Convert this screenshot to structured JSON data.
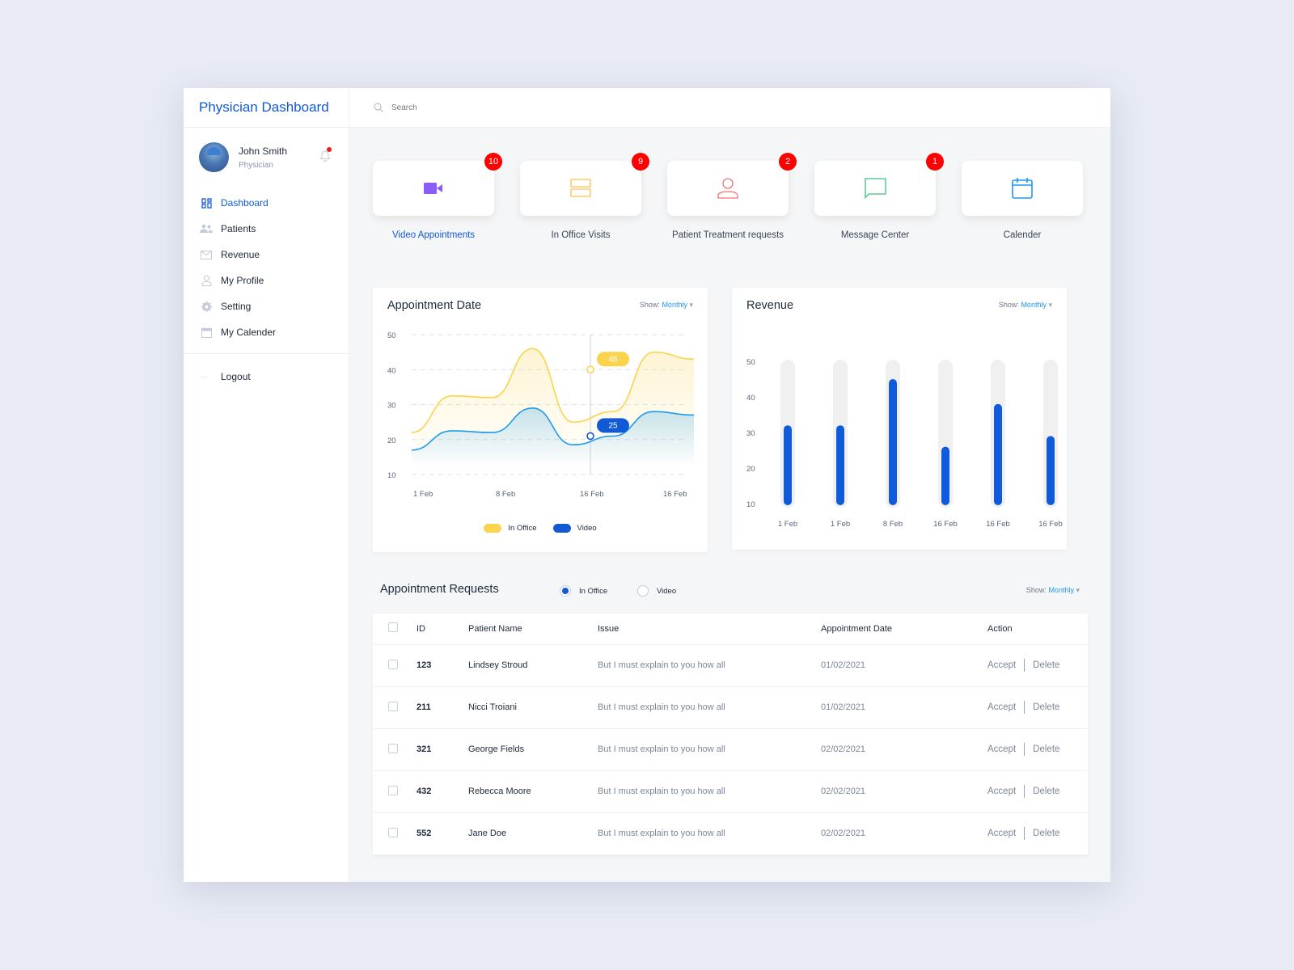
{
  "sidebar": {
    "brand": "Physician Dashboard",
    "user": {
      "name": "John Smith",
      "role": "Physician"
    },
    "nav": [
      {
        "label": "Dashboard",
        "icon": "grid-icon",
        "active": true
      },
      {
        "label": "Patients",
        "icon": "users-icon"
      },
      {
        "label": "Revenue",
        "icon": "mail-icon"
      },
      {
        "label": "My Profile",
        "icon": "user-icon"
      },
      {
        "label": "Setting",
        "icon": "gear-icon"
      },
      {
        "label": "My Calender",
        "icon": "calendar-icon"
      }
    ],
    "logout": "Logout"
  },
  "topbar": {
    "search_placeholder": "Search"
  },
  "tiles": [
    {
      "label": "Video Appointments",
      "badge": "10",
      "icon": "video-icon",
      "color": "#8b5cf6",
      "active": true
    },
    {
      "label": "In Office Visits",
      "badge": "9",
      "icon": "office-icon",
      "color": "#fbbf4a"
    },
    {
      "label": "Patient Treatment requests",
      "badge": "2",
      "icon": "patient-icon",
      "color": "#f87171"
    },
    {
      "label": "Message Center",
      "badge": "1",
      "icon": "message-icon",
      "color": "#34c77b"
    },
    {
      "label": "Calender",
      "badge": null,
      "icon": "calendar-icon",
      "color": "#2196f3"
    }
  ],
  "appointment_chart": {
    "title": "Appointment Date",
    "show_label": "Show:",
    "show_value": "Monthly",
    "legend": [
      "In Office",
      "Video"
    ],
    "tooltips": {
      "in_office": "45",
      "video": "25"
    }
  },
  "revenue_chart": {
    "title": "Revenue",
    "show_label": "Show:",
    "show_value": "Monthly"
  },
  "chart_data": [
    {
      "type": "area",
      "title": "Appointment Date",
      "x": [
        "1 Feb",
        "8 Feb",
        "16 Feb",
        "16 Feb"
      ],
      "ylim": [
        10,
        50
      ],
      "yticks": [
        50,
        40,
        30,
        20,
        10
      ],
      "grid": true,
      "legend_position": "bottom",
      "series": [
        {
          "name": "In Office",
          "color": "#fcd34d",
          "values": [
            22,
            32.5,
            32,
            46,
            25,
            28,
            45,
            43
          ]
        },
        {
          "name": "Video",
          "color": "#1e9be8",
          "values": [
            17,
            22.5,
            22,
            29,
            18.5,
            21,
            28,
            27
          ]
        }
      ],
      "highlight": {
        "x": "16 Feb",
        "in_office": 45,
        "video": 25
      }
    },
    {
      "type": "bar",
      "title": "Revenue",
      "categories": [
        "1 Feb",
        "1 Feb",
        "8 Feb",
        "16 Feb",
        "16 Feb",
        "16 Feb"
      ],
      "values": [
        32,
        32,
        45,
        26,
        38,
        29
      ],
      "ylim": [
        10,
        50
      ],
      "yticks": [
        50,
        40,
        30,
        20,
        10
      ],
      "color": "#0f5bdc"
    }
  ],
  "requests": {
    "title": "Appointment Requests",
    "radios": [
      {
        "label": "In Office",
        "checked": true
      },
      {
        "label": "Video",
        "checked": false
      }
    ],
    "show_label": "Show:",
    "show_value": "Monthly",
    "columns": [
      "ID",
      "Patient Name",
      "Issue",
      "Appointment Date",
      "Action"
    ],
    "rows": [
      {
        "id": "123",
        "name": "Lindsey Stroud",
        "issue": "But I must explain to you how all",
        "date": "01/02/2021"
      },
      {
        "id": "211",
        "name": "Nicci Troiani",
        "issue": "But I must explain to you how all",
        "date": "01/02/2021"
      },
      {
        "id": "321",
        "name": "George Fields",
        "issue": "But I must explain to you how all",
        "date": "02/02/2021"
      },
      {
        "id": "432",
        "name": "Rebecca Moore",
        "issue": "But I must explain to you how all",
        "date": "02/02/2021"
      },
      {
        "id": "552",
        "name": "Jane Doe",
        "issue": "But I must explain to you how all",
        "date": "02/02/2021"
      }
    ],
    "accept_label": "Accept",
    "delete_label": "Delete"
  }
}
